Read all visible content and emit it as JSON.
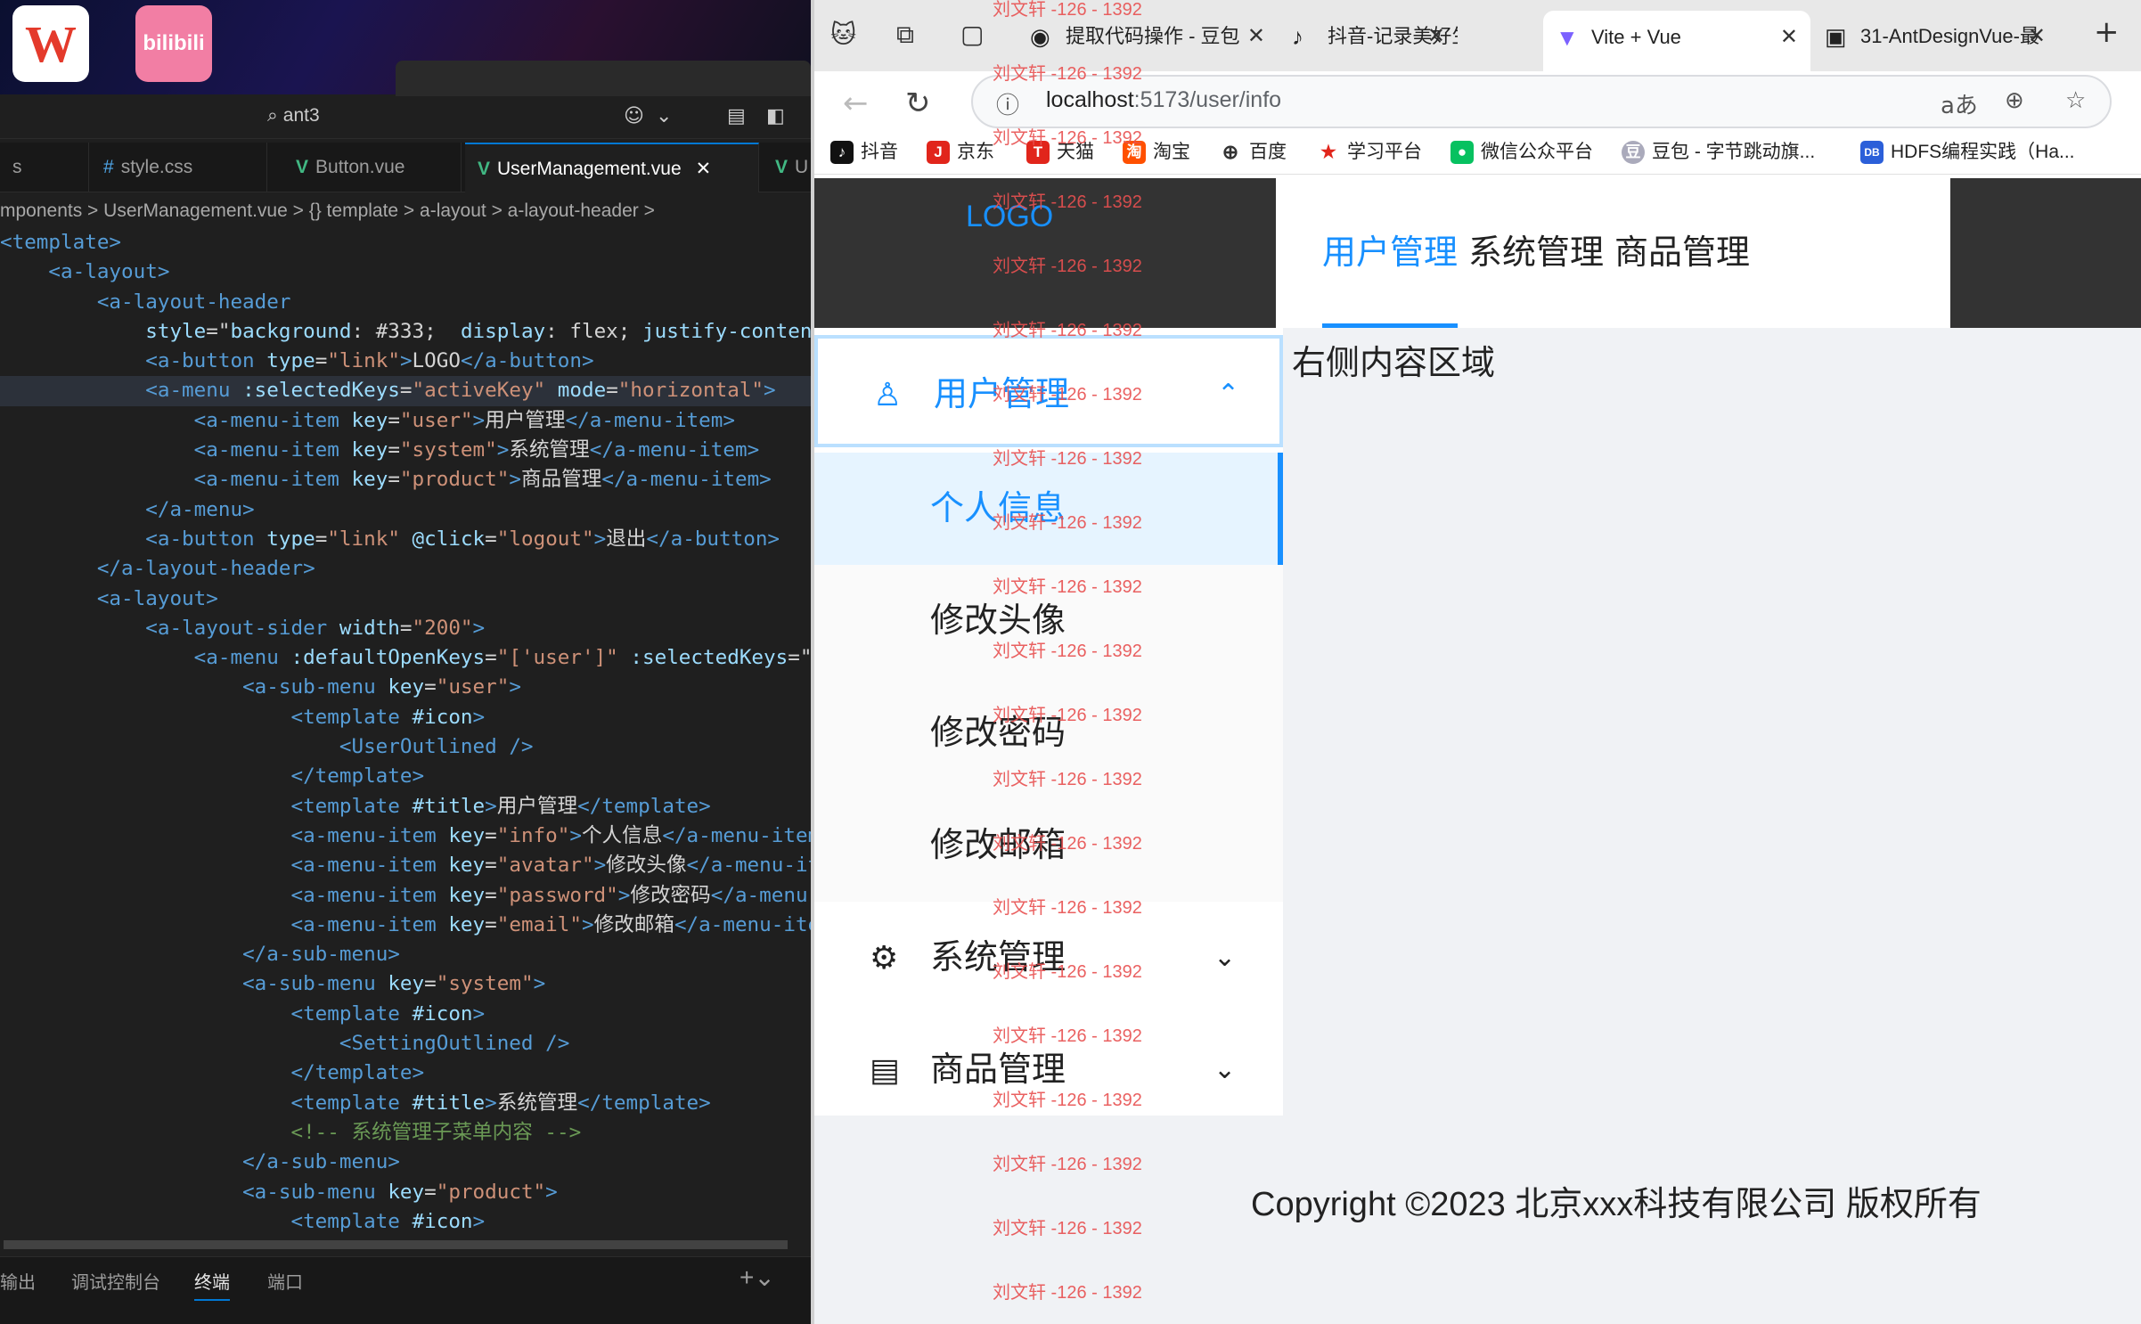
{
  "desktop": {
    "icons": [
      {
        "name": "WPS Office",
        "glyph": "W"
      },
      {
        "name": "哔哩哔哩",
        "glyph": "bilibili"
      }
    ]
  },
  "editor": {
    "search": "ant3",
    "tabs": [
      "s",
      "style.css",
      "Button.vue",
      "UserManagement.vue",
      "U"
    ],
    "breadcrumb": "mponents > UserManagement.vue > {} template > a-layout > a-layout-header >",
    "code_lines": [
      [
        [
          "tg",
          "<template>"
        ]
      ],
      [
        [
          "sp",
          "    "
        ],
        [
          "tg",
          "<a-layout>"
        ]
      ],
      [
        [
          "sp",
          "        "
        ],
        [
          "tg",
          "<a-layout-header"
        ]
      ],
      [
        [
          "sp",
          "            "
        ],
        [
          "at",
          "style"
        ],
        [
          "tx",
          "=\""
        ],
        [
          "at",
          "background"
        ],
        [
          "tx",
          ": #333;  "
        ],
        [
          "at",
          "display"
        ],
        [
          "tx",
          ": flex; "
        ],
        [
          "at",
          "justify-content"
        ]
      ],
      [
        [
          "sp",
          "            "
        ],
        [
          "tg",
          "<a-button"
        ],
        [
          "tx",
          " "
        ],
        [
          "at",
          "type"
        ],
        [
          "tx",
          "="
        ],
        [
          "st",
          "\"link\""
        ],
        [
          "tg",
          ">"
        ],
        [
          "tx",
          "LOGO"
        ],
        [
          "tg",
          "</a-button>"
        ]
      ],
      [
        [
          "sp",
          "            "
        ],
        [
          "tg",
          "<a-menu"
        ],
        [
          "tx",
          " "
        ],
        [
          "at",
          ":selectedKeys"
        ],
        [
          "tx",
          "="
        ],
        [
          "st",
          "\"activeKey\""
        ],
        [
          "tx",
          " "
        ],
        [
          "at",
          "mode"
        ],
        [
          "tx",
          "="
        ],
        [
          "st",
          "\"horizontal\""
        ],
        [
          "tg",
          ">"
        ]
      ],
      [
        [
          "sp",
          "                "
        ],
        [
          "tg",
          "<a-menu-item"
        ],
        [
          "tx",
          " "
        ],
        [
          "at",
          "key"
        ],
        [
          "tx",
          "="
        ],
        [
          "st",
          "\"user\""
        ],
        [
          "tg",
          ">"
        ],
        [
          "tx",
          "用户管理"
        ],
        [
          "tg",
          "</a-menu-item>"
        ]
      ],
      [
        [
          "sp",
          "                "
        ],
        [
          "tg",
          "<a-menu-item"
        ],
        [
          "tx",
          " "
        ],
        [
          "at",
          "key"
        ],
        [
          "tx",
          "="
        ],
        [
          "st",
          "\"system\""
        ],
        [
          "tg",
          ">"
        ],
        [
          "tx",
          "系统管理"
        ],
        [
          "tg",
          "</a-menu-item>"
        ]
      ],
      [
        [
          "sp",
          "                "
        ],
        [
          "tg",
          "<a-menu-item"
        ],
        [
          "tx",
          " "
        ],
        [
          "at",
          "key"
        ],
        [
          "tx",
          "="
        ],
        [
          "st",
          "\"product\""
        ],
        [
          "tg",
          ">"
        ],
        [
          "tx",
          "商品管理"
        ],
        [
          "tg",
          "</a-menu-item>"
        ]
      ],
      [
        [
          "sp",
          "            "
        ],
        [
          "tg",
          "</a-menu>"
        ]
      ],
      [
        [
          "sp",
          "            "
        ],
        [
          "tg",
          "<a-button"
        ],
        [
          "tx",
          " "
        ],
        [
          "at",
          "type"
        ],
        [
          "tx",
          "="
        ],
        [
          "st",
          "\"link\""
        ],
        [
          "tx",
          " "
        ],
        [
          "at",
          "@click"
        ],
        [
          "tx",
          "="
        ],
        [
          "st",
          "\"logout\""
        ],
        [
          "tg",
          ">"
        ],
        [
          "tx",
          "退出"
        ],
        [
          "tg",
          "</a-button>"
        ]
      ],
      [
        [
          "sp",
          "        "
        ],
        [
          "tg",
          "</a-layout-header>"
        ]
      ],
      [
        [
          "sp",
          "        "
        ],
        [
          "tg",
          "<a-layout>"
        ]
      ],
      [
        [
          "sp",
          "            "
        ],
        [
          "tg",
          "<a-layout-sider"
        ],
        [
          "tx",
          " "
        ],
        [
          "at",
          "width"
        ],
        [
          "tx",
          "="
        ],
        [
          "st",
          "\"200\""
        ],
        [
          "tg",
          ">"
        ]
      ],
      [
        [
          "sp",
          "                "
        ],
        [
          "tg",
          "<a-menu"
        ],
        [
          "tx",
          " "
        ],
        [
          "at",
          ":defaultOpenKeys"
        ],
        [
          "tx",
          "="
        ],
        [
          "st",
          "\"['user']\""
        ],
        [
          "tx",
          " "
        ],
        [
          "at",
          ":selectedKeys"
        ],
        [
          "tx",
          "=\""
        ]
      ],
      [
        [
          "sp",
          "                    "
        ],
        [
          "tg",
          "<a-sub-menu"
        ],
        [
          "tx",
          " "
        ],
        [
          "at",
          "key"
        ],
        [
          "tx",
          "="
        ],
        [
          "st",
          "\"user\""
        ],
        [
          "tg",
          ">"
        ]
      ],
      [
        [
          "sp",
          "                        "
        ],
        [
          "tg",
          "<template"
        ],
        [
          "tx",
          " "
        ],
        [
          "at",
          "#icon"
        ],
        [
          "tg",
          ">"
        ]
      ],
      [
        [
          "sp",
          "                            "
        ],
        [
          "tg",
          "<UserOutlined"
        ],
        [
          "tx",
          " "
        ],
        [
          "tg",
          "/>"
        ]
      ],
      [
        [
          "sp",
          "                        "
        ],
        [
          "tg",
          "</template>"
        ]
      ],
      [
        [
          "sp",
          "                        "
        ],
        [
          "tg",
          "<template"
        ],
        [
          "tx",
          " "
        ],
        [
          "at",
          "#title"
        ],
        [
          "tg",
          ">"
        ],
        [
          "tx",
          "用户管理"
        ],
        [
          "tg",
          "</template>"
        ]
      ],
      [
        [
          "sp",
          "                        "
        ],
        [
          "tg",
          "<a-menu-item"
        ],
        [
          "tx",
          " "
        ],
        [
          "at",
          "key"
        ],
        [
          "tx",
          "="
        ],
        [
          "st",
          "\"info\""
        ],
        [
          "tg",
          ">"
        ],
        [
          "tx",
          "个人信息"
        ],
        [
          "tg",
          "</a-menu-item>"
        ]
      ],
      [
        [
          "sp",
          "                        "
        ],
        [
          "tg",
          "<a-menu-item"
        ],
        [
          "tx",
          " "
        ],
        [
          "at",
          "key"
        ],
        [
          "tx",
          "="
        ],
        [
          "st",
          "\"avatar\""
        ],
        [
          "tg",
          ">"
        ],
        [
          "tx",
          "修改头像"
        ],
        [
          "tg",
          "</a-menu-item>"
        ]
      ],
      [
        [
          "sp",
          "                        "
        ],
        [
          "tg",
          "<a-menu-item"
        ],
        [
          "tx",
          " "
        ],
        [
          "at",
          "key"
        ],
        [
          "tx",
          "="
        ],
        [
          "st",
          "\"password\""
        ],
        [
          "tg",
          ">"
        ],
        [
          "tx",
          "修改密码"
        ],
        [
          "tg",
          "</a-menu-item>"
        ]
      ],
      [
        [
          "sp",
          "                        "
        ],
        [
          "tg",
          "<a-menu-item"
        ],
        [
          "tx",
          " "
        ],
        [
          "at",
          "key"
        ],
        [
          "tx",
          "="
        ],
        [
          "st",
          "\"email\""
        ],
        [
          "tg",
          ">"
        ],
        [
          "tx",
          "修改邮箱"
        ],
        [
          "tg",
          "</a-menu-item>"
        ]
      ],
      [
        [
          "sp",
          "                    "
        ],
        [
          "tg",
          "</a-sub-menu>"
        ]
      ],
      [
        [
          "sp",
          "                    "
        ],
        [
          "tg",
          "<a-sub-menu"
        ],
        [
          "tx",
          " "
        ],
        [
          "at",
          "key"
        ],
        [
          "tx",
          "="
        ],
        [
          "st",
          "\"system\""
        ],
        [
          "tg",
          ">"
        ]
      ],
      [
        [
          "sp",
          "                        "
        ],
        [
          "tg",
          "<template"
        ],
        [
          "tx",
          " "
        ],
        [
          "at",
          "#icon"
        ],
        [
          "tg",
          ">"
        ]
      ],
      [
        [
          "sp",
          "                            "
        ],
        [
          "tg",
          "<SettingOutlined"
        ],
        [
          "tx",
          " "
        ],
        [
          "tg",
          "/>"
        ]
      ],
      [
        [
          "sp",
          "                        "
        ],
        [
          "tg",
          "</template>"
        ]
      ],
      [
        [
          "sp",
          "                        "
        ],
        [
          "tg",
          "<template"
        ],
        [
          "tx",
          " "
        ],
        [
          "at",
          "#title"
        ],
        [
          "tg",
          ">"
        ],
        [
          "tx",
          "系统管理"
        ],
        [
          "tg",
          "</template>"
        ]
      ],
      [
        [
          "sp",
          "                        "
        ],
        [
          "cm",
          "<!-- 系统管理子菜单内容 -->"
        ]
      ],
      [
        [
          "sp",
          "                    "
        ],
        [
          "tg",
          "</a-sub-menu>"
        ]
      ],
      [
        [
          "sp",
          "                    "
        ],
        [
          "tg",
          "<a-sub-menu"
        ],
        [
          "tx",
          " "
        ],
        [
          "at",
          "key"
        ],
        [
          "tx",
          "="
        ],
        [
          "st",
          "\"product\""
        ],
        [
          "tg",
          ">"
        ]
      ],
      [
        [
          "sp",
          "                        "
        ],
        [
          "tg",
          "<template"
        ],
        [
          "tx",
          " "
        ],
        [
          "at",
          "#icon"
        ],
        [
          "tg",
          ">"
        ]
      ]
    ],
    "panel_tabs": [
      "输出",
      "调试控制台",
      "终端",
      "端口"
    ]
  },
  "browser": {
    "tabs": [
      {
        "title": "提取代码操作 - 豆包",
        "icon": "doubao-icon"
      },
      {
        "title": "抖音-记录美好生活",
        "icon": "douyin-icon"
      },
      {
        "title": "Vite + Vue",
        "icon": "vite-icon"
      },
      {
        "title": "31-AntDesignVue-最",
        "icon": "image-icon"
      }
    ],
    "url_host": "localhost",
    "url_path": ":5173/user/info",
    "bookmarks": [
      "抖音",
      "京东",
      "天猫",
      "淘宝",
      "百度",
      "学习平台",
      "微信公众平台",
      "豆包 - 字节跳动旗...",
      "HDFS编程实践（Ha..."
    ]
  },
  "app": {
    "logo": "LOGO",
    "top_menu": [
      "用户管理",
      "系统管理",
      "商品管理"
    ],
    "side_menu": {
      "user": "用户管理",
      "user_items": [
        "个人信息",
        "修改头像",
        "修改密码",
        "修改邮箱"
      ],
      "system": "系统管理",
      "product": "商品管理"
    },
    "content": "右侧内容区域",
    "footer": "Copyright ©2023 北京xxx科技有限公司 版权所有"
  },
  "watermark": "刘文轩 -126 - 1392"
}
